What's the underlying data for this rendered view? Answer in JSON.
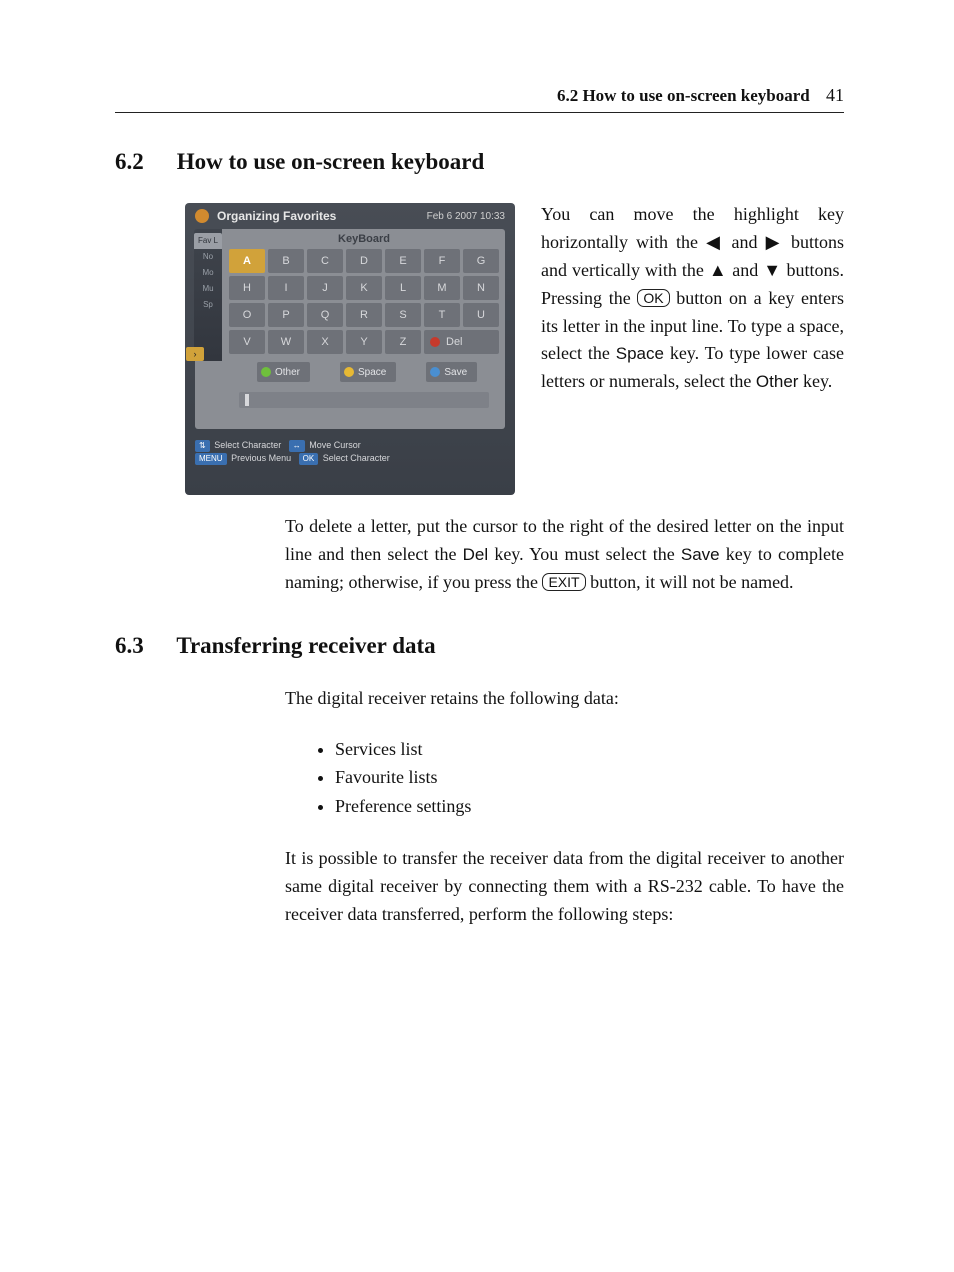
{
  "header": {
    "section_ref": "6.2 How to use on-screen keyboard",
    "page_number": "41"
  },
  "sec62": {
    "number": "6.2",
    "title": "How to use on-screen keyboard",
    "para_side_1": "You can move the highlight key horizontally with the ",
    "arrow_left": "◀",
    "para_side_2": " and ",
    "arrow_right": "▶",
    "para_side_3": " buttons and vertically with the ",
    "arrow_up": "▲",
    "para_side_4": " and ",
    "arrow_down": "▼",
    "para_side_5": " buttons. Pressing the ",
    "ok_label": "OK",
    "para_side_6": " button on a key enters its letter in the input line. To type a space, select the ",
    "space_key": "Space",
    "para_side_7": " key. To type lower case letters or numerals, select the ",
    "other_key": "Other",
    "para_side_8": " key.",
    "para2_a": "To delete a letter, put the cursor to the right of the desired letter on the input line and then select the ",
    "del_key": "Del",
    "para2_b": " key. You must select the ",
    "save_key": "Save",
    "para2_c": " key to complete naming; otherwise, if you press the ",
    "exit_label": "EXIT",
    "para2_d": " button, it will not be named."
  },
  "sec63": {
    "number": "6.3",
    "title": "Transferring receiver data",
    "intro": "The digital receiver retains the following data:",
    "items": [
      "Services list",
      "Favourite lists",
      "Preference settings"
    ],
    "para": "It is possible to transfer the receiver data from the digital receiver to another same digital receiver by connecting them with a RS-232 cable. To have the receiver data transferred, perform the following steps:"
  },
  "screenshot": {
    "title": "Organizing Favorites",
    "timestamp": "Feb 6 2007 10:33",
    "sidetabs": [
      "Fav L",
      "No",
      "Mo",
      "Mu",
      "Sp"
    ],
    "kbd_header": "KeyBoard",
    "rows": [
      [
        "A",
        "B",
        "C",
        "D",
        "E",
        "F",
        "G"
      ],
      [
        "H",
        "I",
        "J",
        "K",
        "L",
        "M",
        "N"
      ],
      [
        "O",
        "P",
        "Q",
        "R",
        "S",
        "T",
        "U"
      ],
      [
        "V",
        "W",
        "X",
        "Y",
        "Z"
      ]
    ],
    "del_label": "Del",
    "soft_other": "Other",
    "soft_space": "Space",
    "soft_save": "Save",
    "legend1_pill": "⇅",
    "legend1_a": "Select Character",
    "legend1_b_pill": "↔",
    "legend1_b": "Move Cursor",
    "legend2_menu": "MENU",
    "legend2_a": "Previous Menu",
    "legend2_ok": "OK",
    "legend2_b": "Select Character"
  }
}
